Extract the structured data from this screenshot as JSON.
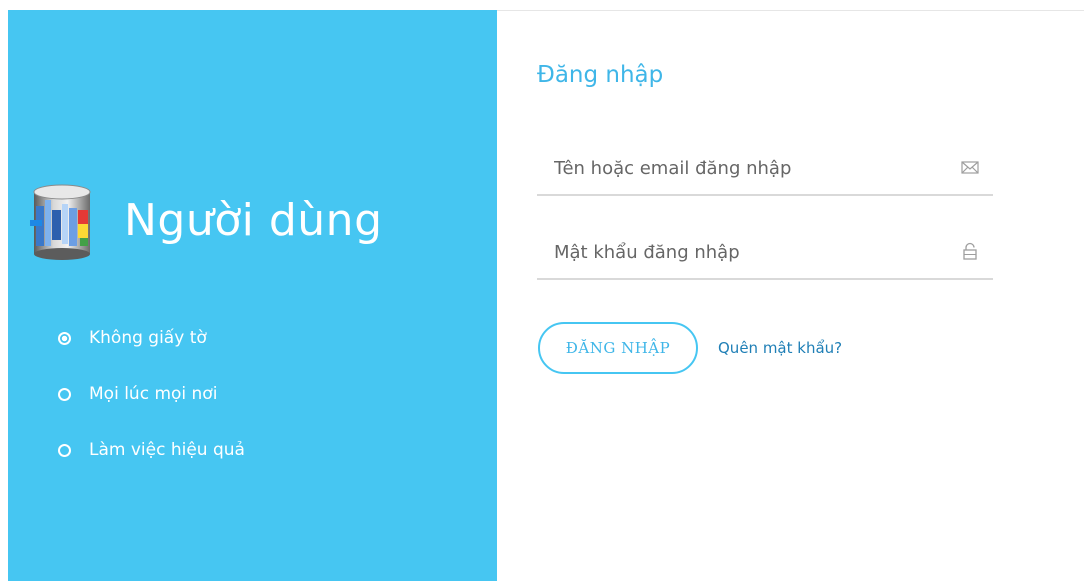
{
  "left_panel": {
    "brand_title": "Người dùng",
    "features": [
      "Không giấy tờ",
      "Mọi lúc mọi nơi",
      "Làm việc hiệu quả"
    ]
  },
  "login_form": {
    "title": "Đăng nhập",
    "username": {
      "placeholder": "Tên hoặc email đăng nhập",
      "value": "",
      "icon": "envelope-icon"
    },
    "password": {
      "placeholder": "Mật khẩu đăng nhập",
      "value": "",
      "icon": "lock-icon"
    },
    "submit_label": "ĐĂNG NHẬP",
    "forgot_label": "Quên mật khẩu?"
  },
  "colors": {
    "panel_bg": "#46c6f2",
    "accent": "#3fb6e8",
    "link": "#1f7fb6"
  }
}
